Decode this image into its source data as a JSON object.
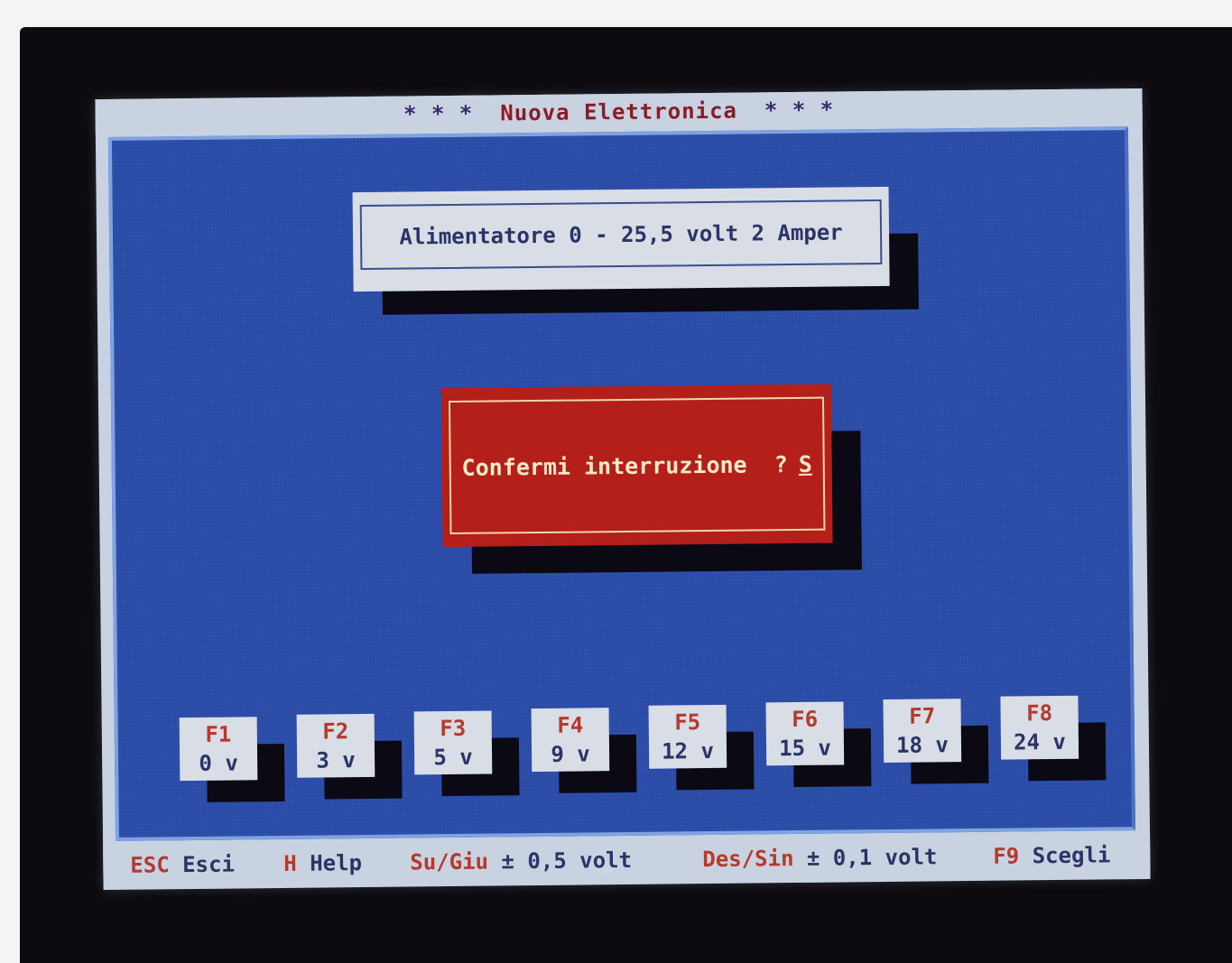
{
  "title": {
    "stars_left": "* * *",
    "text": "Nuova Elettronica",
    "stars_right": "* * *"
  },
  "header": {
    "label": "Alimentatore 0 - 25,5 volt  2 Amper"
  },
  "dialog": {
    "prompt": "Confermi interruzione  ?",
    "answer": "S"
  },
  "presets": [
    {
      "key": "F1",
      "value": "0 v"
    },
    {
      "key": "F2",
      "value": "3 v"
    },
    {
      "key": "F3",
      "value": "5 v"
    },
    {
      "key": "F4",
      "value": "9 v"
    },
    {
      "key": "F5",
      "value": "12 v"
    },
    {
      "key": "F6",
      "value": "15 v"
    },
    {
      "key": "F7",
      "value": "18 v"
    },
    {
      "key": "F8",
      "value": "24 v"
    }
  ],
  "status": {
    "esc_key": "ESC",
    "esc_label": "Esci",
    "help_key": "H",
    "help_label": "Help",
    "updown_key": "Su/Giu",
    "updown_label": "± 0,5 volt",
    "leftright_key": "Des/Sin",
    "leftright_label": "± 0,1 volt",
    "choose_key": "F9",
    "choose_label": "Scegli"
  },
  "colors": {
    "workspace": "#2a4ba7",
    "dialog": "#b41f1a",
    "panel": "#d8dde6",
    "key_text": "#b33a2c"
  }
}
